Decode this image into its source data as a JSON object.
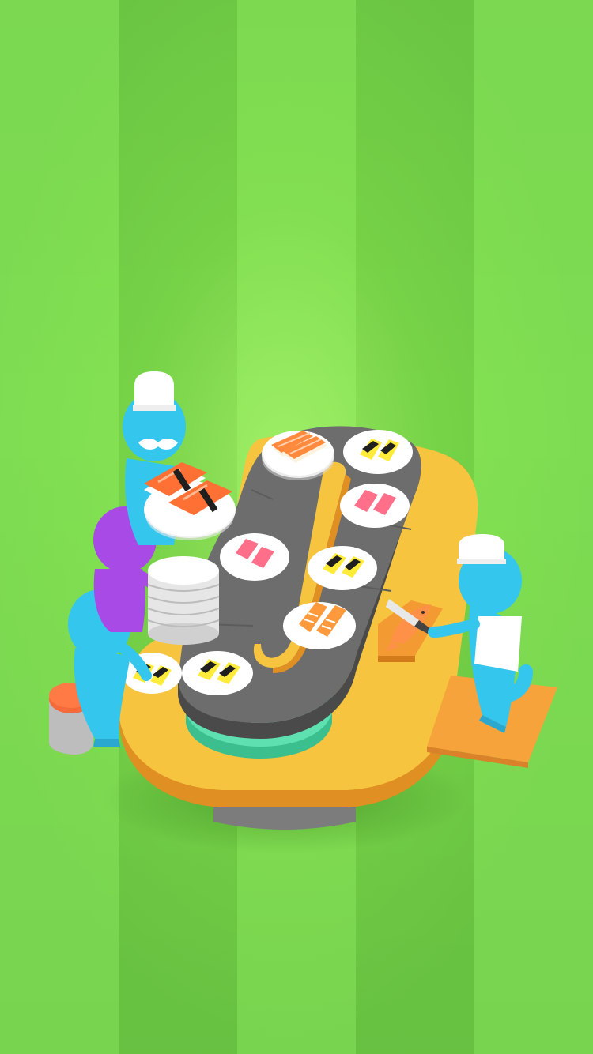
{
  "scene": {
    "name": "sushi-restaurant-idle",
    "background_colors": {
      "light_stripe": "#7ddc52",
      "dark_stripe": "#6cc944"
    },
    "table_color": "#f6c43e",
    "belt_color": "#6b6b6b",
    "character_blue": "#35c6ee",
    "character_purple": "#a84ae6",
    "counter_color": "#f7a33b"
  },
  "characters": [
    {
      "role": "sushi-chef",
      "color": "#35c6ee",
      "wears": "chef-hat-and-mustache"
    },
    {
      "role": "customer",
      "color": "#a84ae6"
    },
    {
      "role": "customer",
      "color": "#35c6ee"
    },
    {
      "role": "fish-cutter-chef",
      "color": "#35c6ee",
      "wears": "chef-hat-and-apron"
    }
  ],
  "plates": [
    {
      "item": "salmon-nigiri"
    },
    {
      "item": "tamago-nigiri"
    },
    {
      "item": "tuna-nigiri"
    },
    {
      "item": "tuna-nigiri"
    },
    {
      "item": "tamago-nigiri"
    },
    {
      "item": "shrimp-nigiri"
    },
    {
      "item": "tamago-nigiri"
    },
    {
      "item": "tamago-nigiri"
    }
  ]
}
